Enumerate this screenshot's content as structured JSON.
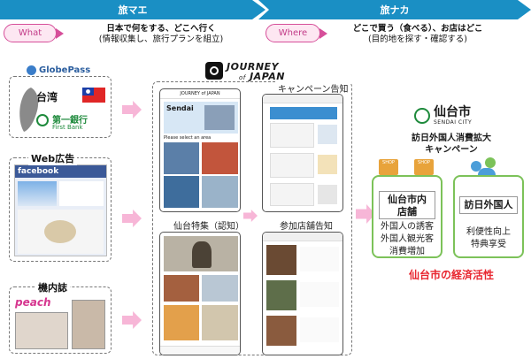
{
  "phases": {
    "left": "旅マエ",
    "right": "旅ナカ"
  },
  "what": {
    "pill": "What",
    "line1": "日本で何をする、どこへ行く",
    "line2": "(情報収集し、旅行プランを組立)"
  },
  "where": {
    "pill": "Where",
    "line1": "どこで買う（食べる）、お店はどこ",
    "line2": "(目的地を探す・確認する)"
  },
  "globepass": {
    "logo": "GlobePass",
    "country": "台湾",
    "bank_name": "第一銀行",
    "bank_en": "First Bank"
  },
  "web_ad": {
    "title": "Web広告",
    "facebook": "facebook"
  },
  "inflight": {
    "title": "機内誌",
    "peach": "peach"
  },
  "journey": {
    "logo_top": "JOURNEY",
    "logo_of": "of",
    "logo_bottom": "JAPAN",
    "phone_header": "JOURNEY of JAPAN",
    "sendai_card": "Sendai",
    "select_area": "Please select an area"
  },
  "labels": {
    "campaign": "キャンペーン告知",
    "sendai_feature": "仙台特集（認知）",
    "participating": "参加店舗告知"
  },
  "sendai_city": {
    "logo_jp": "仙台市",
    "logo_en": "SENDAI CITY",
    "campaign_line1": "訪日外国人消費拡大",
    "campaign_line2": "キャンペーン",
    "stores_title_line1": "仙台市内",
    "stores_title_line2": "店舗",
    "stores_body_line1": "外国人の誘客",
    "stores_body_line2": "外国人観光客",
    "stores_body_line3": "消費増加",
    "shop_sign": "SHOP",
    "visitors_title": "訪日外国人",
    "visitors_body_line1": "利便性向上",
    "visitors_body_line2": "特典享受",
    "result": "仙台市の経済活性"
  },
  "colors": {
    "chevron": "#1a8fc4",
    "pill_border": "#d64f9a",
    "arrow": "#f7b6d7",
    "green_border": "#7cc259",
    "result_red": "#e8262f"
  }
}
